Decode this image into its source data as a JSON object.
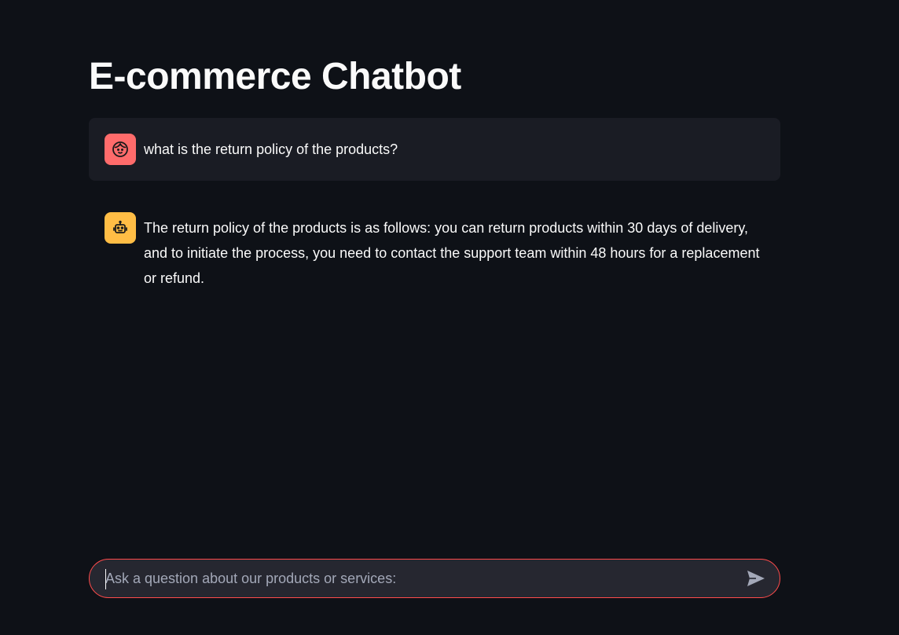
{
  "app": {
    "title": "E-commerce Chatbot"
  },
  "messages": [
    {
      "role": "user",
      "avatar_icon": "user-face-icon",
      "avatar_color": "#ff6b6b",
      "text": "what is the return policy of the products?"
    },
    {
      "role": "assistant",
      "avatar_icon": "robot-icon",
      "avatar_color": "#ffbd45",
      "text": "The return policy of the products is as follows: you can return products within 30 days of delivery, and to initiate the process, you need to contact the support team within 48 hours for a replacement or refund."
    }
  ],
  "chat_input": {
    "placeholder": "Ask a question about our products or services:",
    "value": "",
    "send_icon": "send-icon",
    "border_color": "#ff4b4b"
  },
  "colors": {
    "background": "#0e1117",
    "user_message_bg": "#1a1c24",
    "input_bg": "#262730"
  }
}
